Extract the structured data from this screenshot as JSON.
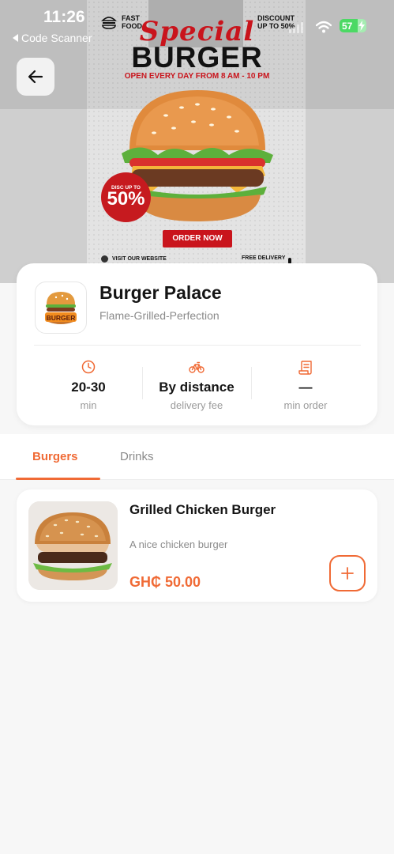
{
  "status_bar": {
    "time": "11:26",
    "back_app": "Code Scanner",
    "battery": "57"
  },
  "banner": {
    "tag_fast": "FAST\nFOOD",
    "tag_discount": "DISCOUNT\nUP TO 50%",
    "special": "Special",
    "headline": "BURGER",
    "hours": "OPEN EVERY DAY FROM 8 AM - 10 PM",
    "disc_small": "DISC UP TO",
    "disc_big": "50%",
    "cta": "ORDER NOW",
    "visit": "VISIT OUR WEBSITE",
    "free_delivery": "FREE DELIVERY",
    "logo_text": "BURGER"
  },
  "restaurant": {
    "name": "Burger Palace",
    "tagline": "Flame-Grilled-Perfection",
    "stats": [
      {
        "icon": "clock-icon",
        "value": "20-30",
        "label": "min"
      },
      {
        "icon": "bicycle-icon",
        "value": "By distance",
        "label": "delivery fee"
      },
      {
        "icon": "receipt-icon",
        "value": "—",
        "label": "min order"
      }
    ]
  },
  "tabs": [
    {
      "label": "Burgers",
      "active": true
    },
    {
      "label": "Drinks",
      "active": false
    }
  ],
  "menu_items": [
    {
      "name": "Grilled Chicken Burger",
      "description": "A nice chicken burger",
      "price": "GH₵ 50.00"
    }
  ],
  "colors": {
    "accent": "#f06a35",
    "banner_red": "#c9141c",
    "battery_green": "#4cd964"
  }
}
